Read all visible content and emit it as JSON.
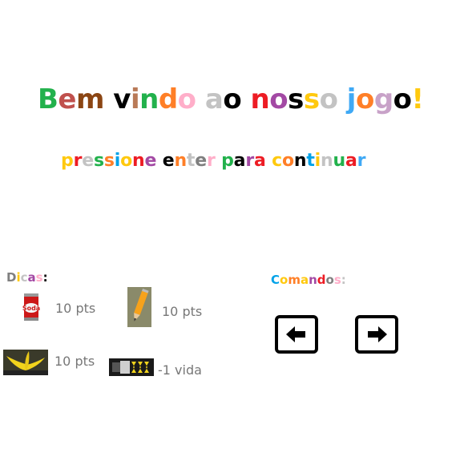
{
  "title": {
    "text": "Bem vindo ao nosso jogo!",
    "letter_colors": [
      "#22b14c",
      "#c0504d",
      "#8b4513",
      "#000000",
      "#b97a57",
      "#22b14c",
      "#ff7f27",
      "#ffaec9",
      "#c3c3c3",
      "#000000",
      "#ed1c24",
      "#a349a4",
      "#000000",
      "#ffc90e",
      "#c3c3c3",
      "#3fa9f5",
      "#ff7f27",
      "#c8a2c8",
      "#000000",
      "#ffc90e",
      "#c3c3c3",
      "#000000",
      "#a349a4",
      "#7f7f7f"
    ]
  },
  "subtitle": {
    "text": "pressione enter para continuar",
    "letter_colors": [
      "#ffc90e",
      "#ed1c24",
      "#c3c3c3",
      "#22b14c",
      "#ff7f27",
      "#00a2e8",
      "#ffc90e",
      "#ed1c24",
      "#a349a4",
      "#000000",
      "#ff7f27",
      "#c3c3c3",
      "#7f7f7f",
      "#ffaec9",
      "#22b14c",
      "#000000",
      "#a349a4",
      "#ed1c24",
      "#ffc90e",
      "#ff7f27",
      "#000000",
      "#00a2e8",
      "#ffc90e",
      "#c3c3c3",
      "#22b14c",
      "#ed1c24",
      "#3fa9f5",
      "#7f7f7f",
      "#ffc90e",
      "#c0504d"
    ]
  },
  "dicas": {
    "label": "Dicas:",
    "letter_colors": [
      "#7f7f7f",
      "#ffc90e",
      "#c3c3c3",
      "#a349a4",
      "#ffaec9",
      "#000000"
    ],
    "items": [
      {
        "icon": "soda-can-icon",
        "value": "10 pts"
      },
      {
        "icon": "pencil-icon",
        "value": "10 pts"
      },
      {
        "icon": "banana-peel-icon",
        "value": "10 pts"
      },
      {
        "icon": "battery-icon",
        "value": "-1 vida"
      }
    ]
  },
  "comandos": {
    "label": "Comandos:",
    "letter_colors": [
      "#00a2e8",
      "#ffc90e",
      "#ff7f27",
      "#ffc90e",
      "#a349a4",
      "#ed1c24",
      "#7f7f7f",
      "#ffaec9",
      "#c3c3c3"
    ],
    "keys": [
      {
        "icon": "left-arrow-key-icon",
        "direction": "left"
      },
      {
        "icon": "right-arrow-key-icon",
        "direction": "right"
      }
    ]
  }
}
